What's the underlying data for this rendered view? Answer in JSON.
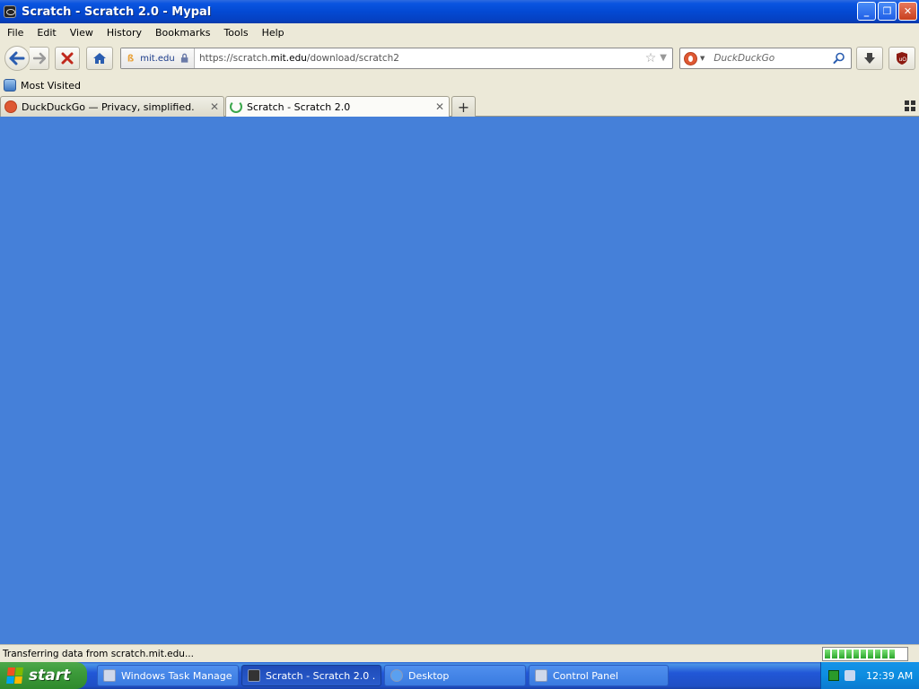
{
  "window": {
    "title": "Scratch - Scratch 2.0 - Mypal",
    "minimize": "_",
    "restore": "❐",
    "close": "✕"
  },
  "menu": [
    "File",
    "Edit",
    "View",
    "History",
    "Bookmarks",
    "Tools",
    "Help"
  ],
  "nav": {
    "identity_host": "mit.edu",
    "url_prefix": "https://scratch.",
    "url_host": "mit.edu",
    "url_path": "/download/scratch2",
    "search_engine": "DuckDuckGo",
    "search_placeholder": "DuckDuckGo"
  },
  "bookmarks": {
    "most_visited": "Most Visited"
  },
  "tabs": [
    {
      "label": "DuckDuckGo — Privacy, simplified.",
      "active": false
    },
    {
      "label": "Scratch - Scratch 2.0",
      "active": true
    }
  ],
  "content": {
    "background": "#4580d9"
  },
  "status": {
    "text": "Transferring data from scratch.mit.edu...",
    "progress_segments": 10
  },
  "taskbar": {
    "start_label": "start",
    "tasks": [
      {
        "label": "Windows Task Manager",
        "active": false
      },
      {
        "label": "Scratch - Scratch 2.0 ...",
        "active": true
      },
      {
        "label": "Desktop",
        "active": false
      },
      {
        "label": "Control Panel",
        "active": false
      }
    ],
    "clock": "12:39 AM"
  },
  "colors": {
    "titlebar": "#0349d3",
    "chrome": "#ece9d8",
    "content": "#4580d9",
    "taskbar": "#2157d7",
    "start": "#3c9a3a"
  }
}
